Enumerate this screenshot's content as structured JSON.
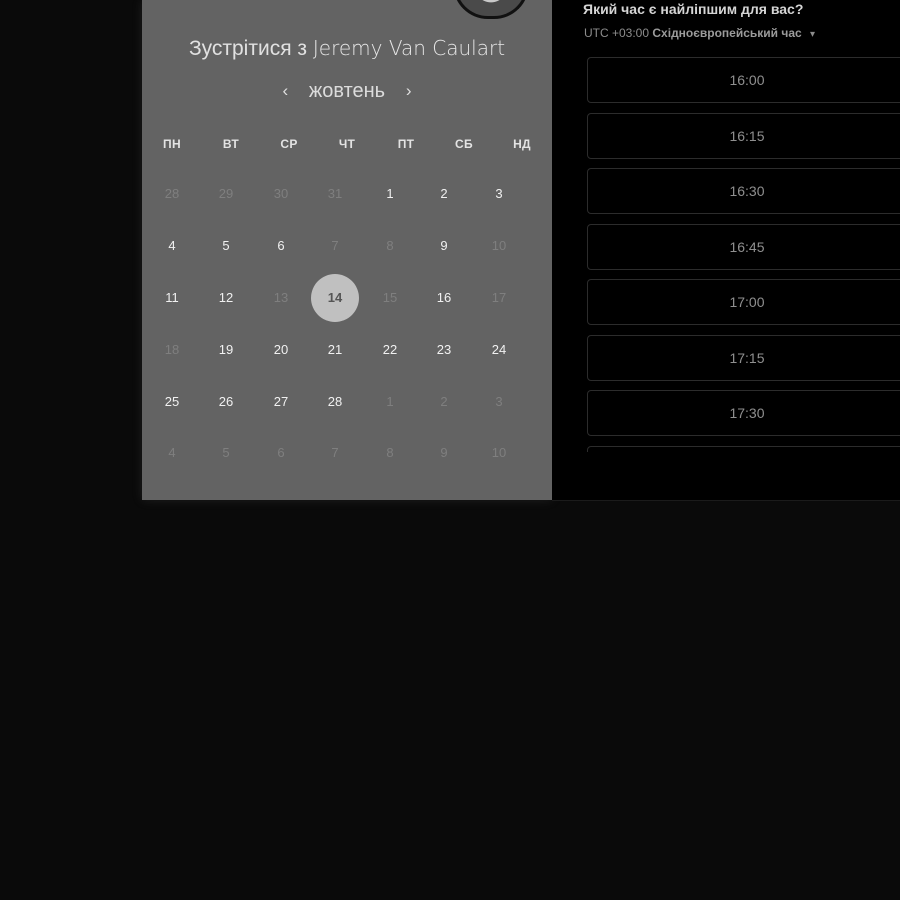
{
  "header": {
    "meet_prefix": "Зустрітися з",
    "host_name": "Jeremy Van Caulart"
  },
  "calendar": {
    "month_label": "жовтень",
    "prev_icon": "chevron-left-icon",
    "next_icon": "chevron-right-icon",
    "weekdays": [
      "ПН",
      "ВТ",
      "СР",
      "ЧТ",
      "ПТ",
      "СБ",
      "НД"
    ],
    "weeks": [
      [
        {
          "day": "28",
          "available": false
        },
        {
          "day": "29",
          "available": false
        },
        {
          "day": "30",
          "available": false
        },
        {
          "day": "31",
          "available": false
        },
        {
          "day": "1",
          "available": true
        },
        {
          "day": "2",
          "available": true
        },
        {
          "day": "3",
          "available": true
        }
      ],
      [
        {
          "day": "4",
          "available": true
        },
        {
          "day": "5",
          "available": true
        },
        {
          "day": "6",
          "available": true
        },
        {
          "day": "7",
          "available": false
        },
        {
          "day": "8",
          "available": false
        },
        {
          "day": "9",
          "available": true
        },
        {
          "day": "10",
          "available": false
        }
      ],
      [
        {
          "day": "11",
          "available": true
        },
        {
          "day": "12",
          "available": true
        },
        {
          "day": "13",
          "available": false
        },
        {
          "day": "14",
          "available": true,
          "selected": true
        },
        {
          "day": "15",
          "available": false
        },
        {
          "day": "16",
          "available": true
        },
        {
          "day": "17",
          "available": false
        }
      ],
      [
        {
          "day": "18",
          "available": false
        },
        {
          "day": "19",
          "available": true
        },
        {
          "day": "20",
          "available": true
        },
        {
          "day": "21",
          "available": true
        },
        {
          "day": "22",
          "available": true
        },
        {
          "day": "23",
          "available": true
        },
        {
          "day": "24",
          "available": true
        }
      ],
      [
        {
          "day": "25",
          "available": true
        },
        {
          "day": "26",
          "available": true
        },
        {
          "day": "27",
          "available": true
        },
        {
          "day": "28",
          "available": true
        },
        {
          "day": "1",
          "available": false
        },
        {
          "day": "2",
          "available": false
        },
        {
          "day": "3",
          "available": false
        }
      ],
      [
        {
          "day": "4",
          "available": false
        },
        {
          "day": "5",
          "available": false
        },
        {
          "day": "6",
          "available": false
        },
        {
          "day": "7",
          "available": false
        },
        {
          "day": "8",
          "available": false
        },
        {
          "day": "9",
          "available": false
        },
        {
          "day": "10",
          "available": false
        }
      ]
    ]
  },
  "times": {
    "question": "Який час є найліпшим для вас?",
    "timezone_offset": "UTC +03:00",
    "timezone_name": "Східноєвропейський час",
    "timezone_dropdown_icon": "caret-down-icon",
    "slots": [
      "16:00",
      "16:15",
      "16:30",
      "16:45",
      "17:00",
      "17:15",
      "17:30",
      ""
    ]
  },
  "colors": {
    "page_background": "#0a0a0a",
    "calendar_panel": "#636363",
    "times_panel": "#000000",
    "selected_day": "#c0c0c0"
  }
}
